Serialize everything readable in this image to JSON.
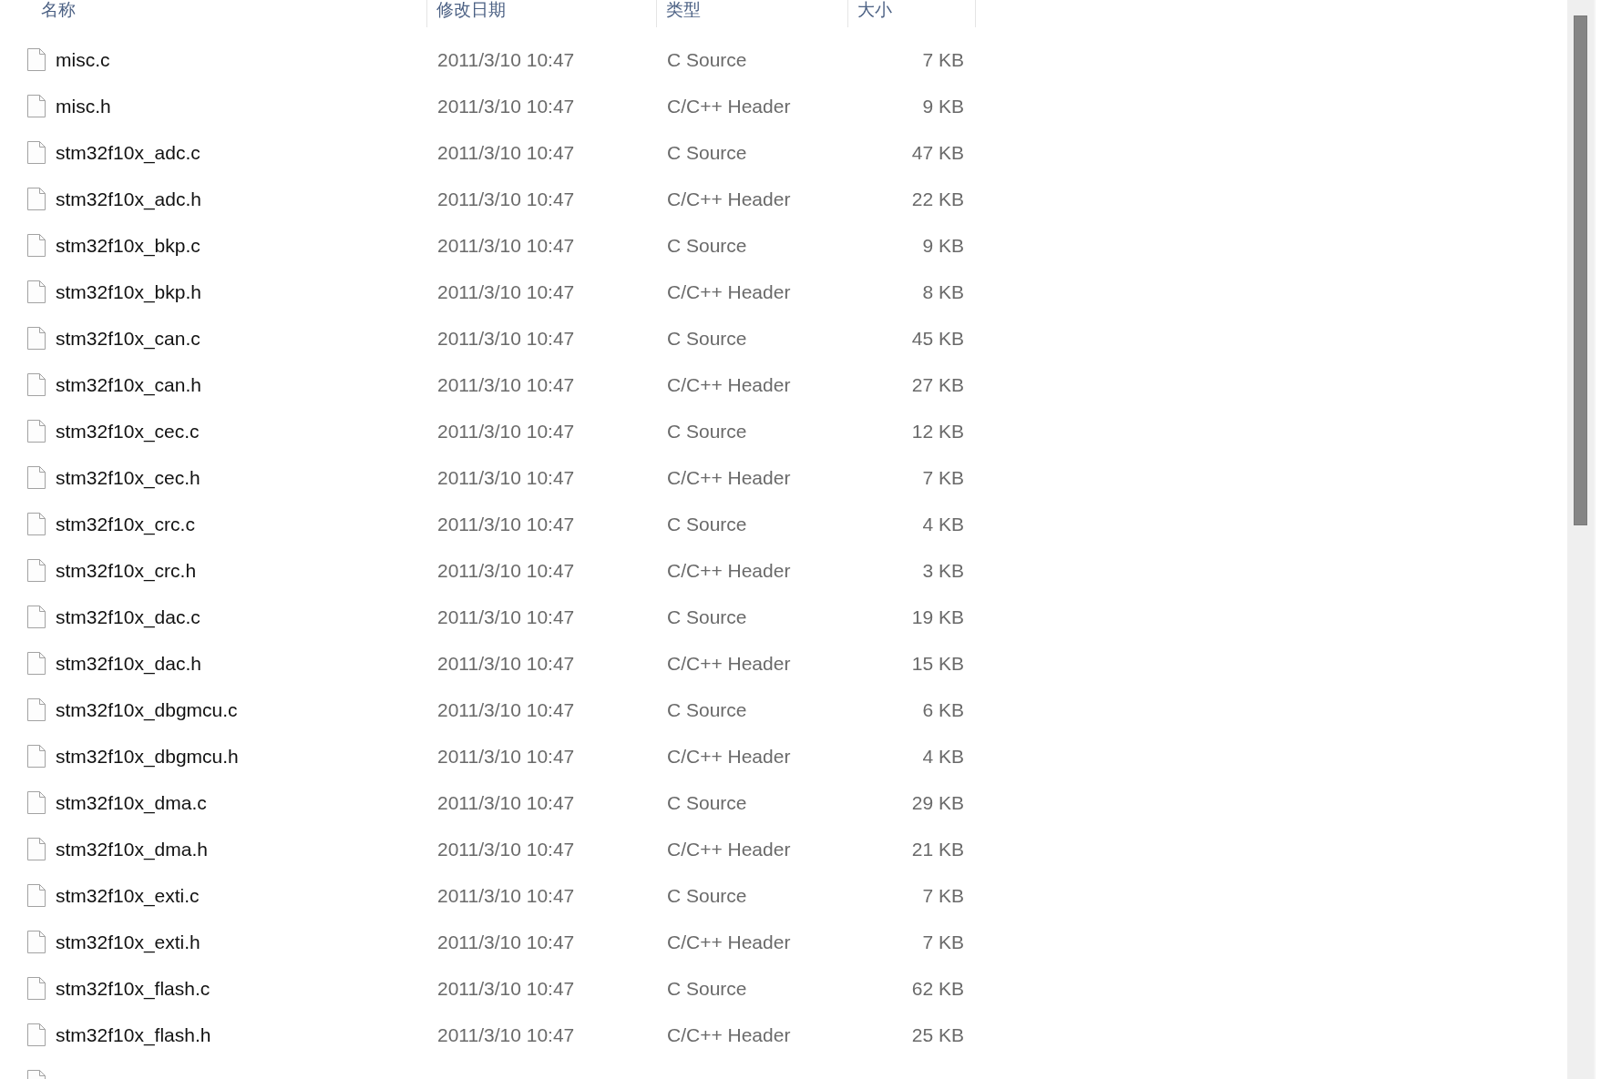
{
  "columns": [
    {
      "label": "名称"
    },
    {
      "label": "修改日期"
    },
    {
      "label": "类型"
    },
    {
      "label": "大小"
    }
  ],
  "files": [
    {
      "name": "misc.c",
      "modified": "2011/3/10 10:47",
      "type": "C Source",
      "size": "7 KB",
      "selected": false
    },
    {
      "name": "misc.h",
      "modified": "2011/3/10 10:47",
      "type": "C/C++ Header",
      "size": "9 KB",
      "selected": false
    },
    {
      "name": "stm32f10x_adc.c",
      "modified": "2011/3/10 10:47",
      "type": "C Source",
      "size": "47 KB",
      "selected": false
    },
    {
      "name": "stm32f10x_adc.h",
      "modified": "2011/3/10 10:47",
      "type": "C/C++ Header",
      "size": "22 KB",
      "selected": false
    },
    {
      "name": "stm32f10x_bkp.c",
      "modified": "2011/3/10 10:47",
      "type": "C Source",
      "size": "9 KB",
      "selected": false
    },
    {
      "name": "stm32f10x_bkp.h",
      "modified": "2011/3/10 10:47",
      "type": "C/C++ Header",
      "size": "8 KB",
      "selected": false
    },
    {
      "name": "stm32f10x_can.c",
      "modified": "2011/3/10 10:47",
      "type": "C Source",
      "size": "45 KB",
      "selected": false
    },
    {
      "name": "stm32f10x_can.h",
      "modified": "2011/3/10 10:47",
      "type": "C/C++ Header",
      "size": "27 KB",
      "selected": false
    },
    {
      "name": "stm32f10x_cec.c",
      "modified": "2011/3/10 10:47",
      "type": "C Source",
      "size": "12 KB",
      "selected": false
    },
    {
      "name": "stm32f10x_cec.h",
      "modified": "2011/3/10 10:47",
      "type": "C/C++ Header",
      "size": "7 KB",
      "selected": false
    },
    {
      "name": "stm32f10x_crc.c",
      "modified": "2011/3/10 10:47",
      "type": "C Source",
      "size": "4 KB",
      "selected": false
    },
    {
      "name": "stm32f10x_crc.h",
      "modified": "2011/3/10 10:47",
      "type": "C/C++ Header",
      "size": "3 KB",
      "selected": false
    },
    {
      "name": "stm32f10x_dac.c",
      "modified": "2011/3/10 10:47",
      "type": "C Source",
      "size": "19 KB",
      "selected": false
    },
    {
      "name": "stm32f10x_dac.h",
      "modified": "2011/3/10 10:47",
      "type": "C/C++ Header",
      "size": "15 KB",
      "selected": false
    },
    {
      "name": "stm32f10x_dbgmcu.c",
      "modified": "2011/3/10 10:47",
      "type": "C Source",
      "size": "6 KB",
      "selected": false
    },
    {
      "name": "stm32f10x_dbgmcu.h",
      "modified": "2011/3/10 10:47",
      "type": "C/C++ Header",
      "size": "4 KB",
      "selected": false
    },
    {
      "name": "stm32f10x_dma.c",
      "modified": "2011/3/10 10:47",
      "type": "C Source",
      "size": "29 KB",
      "selected": false
    },
    {
      "name": "stm32f10x_dma.h",
      "modified": "2011/3/10 10:47",
      "type": "C/C++ Header",
      "size": "21 KB",
      "selected": false
    },
    {
      "name": "stm32f10x_exti.c",
      "modified": "2011/3/10 10:47",
      "type": "C Source",
      "size": "7 KB",
      "selected": false
    },
    {
      "name": "stm32f10x_exti.h",
      "modified": "2011/3/10 10:47",
      "type": "C/C++ Header",
      "size": "7 KB",
      "selected": false
    },
    {
      "name": "stm32f10x_flash.c",
      "modified": "2011/3/10 10:47",
      "type": "C Source",
      "size": "62 KB",
      "selected": false
    },
    {
      "name": "stm32f10x_flash.h",
      "modified": "2011/3/10 10:47",
      "type": "C/C++ Header",
      "size": "25 KB",
      "selected": false
    }
  ]
}
